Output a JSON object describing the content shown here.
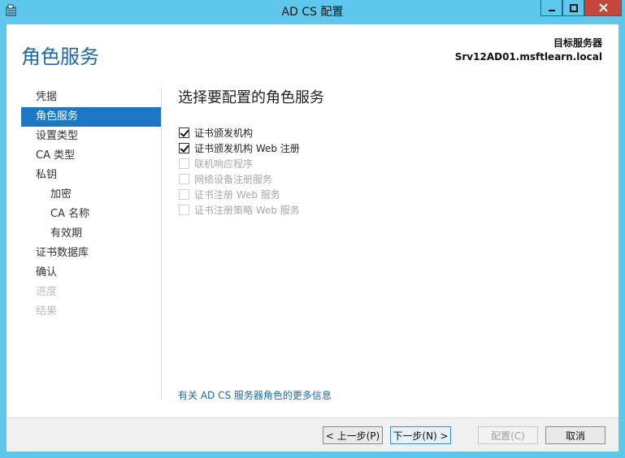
{
  "window": {
    "title": "AD CS 配置"
  },
  "header": {
    "page_title": "角色服务",
    "target_label": "目标服务器",
    "target_value": "Srv12AD01.msftlearn.local"
  },
  "nav": {
    "items": [
      {
        "label": "凭据",
        "state": "normal",
        "level": 0
      },
      {
        "label": "角色服务",
        "state": "active",
        "level": 0
      },
      {
        "label": "设置类型",
        "state": "normal",
        "level": 0
      },
      {
        "label": "CA 类型",
        "state": "normal",
        "level": 0
      },
      {
        "label": "私钥",
        "state": "normal",
        "level": 0
      },
      {
        "label": "加密",
        "state": "normal",
        "level": 1
      },
      {
        "label": "CA 名称",
        "state": "normal",
        "level": 1
      },
      {
        "label": "有效期",
        "state": "normal",
        "level": 1
      },
      {
        "label": "证书数据库",
        "state": "normal",
        "level": 0
      },
      {
        "label": "确认",
        "state": "normal",
        "level": 0
      },
      {
        "label": "进度",
        "state": "disabled",
        "level": 0
      },
      {
        "label": "结果",
        "state": "disabled",
        "level": 0
      }
    ]
  },
  "main": {
    "title": "选择要配置的角色服务",
    "options": [
      {
        "label": "证书颁发机构",
        "checked": true,
        "enabled": true
      },
      {
        "label": "证书颁发机构 Web 注册",
        "checked": true,
        "enabled": true
      },
      {
        "label": "联机响应程序",
        "checked": false,
        "enabled": false
      },
      {
        "label": "网络设备注册服务",
        "checked": false,
        "enabled": false
      },
      {
        "label": "证书注册 Web 服务",
        "checked": false,
        "enabled": false
      },
      {
        "label": "证书注册策略 Web 服务",
        "checked": false,
        "enabled": false
      }
    ],
    "more_info_link": "有关 AD CS 服务器角色的更多信息"
  },
  "footer": {
    "prev_label": "< 上一步(P)",
    "next_label": "下一步(N) >",
    "config_label": "配置(C)",
    "cancel_label": "取消"
  },
  "colors": {
    "accent": "#1c78c2",
    "title_blue": "#1a6aa8",
    "window_chrome": "#5ec7ec",
    "close_button": "#c7463a"
  }
}
